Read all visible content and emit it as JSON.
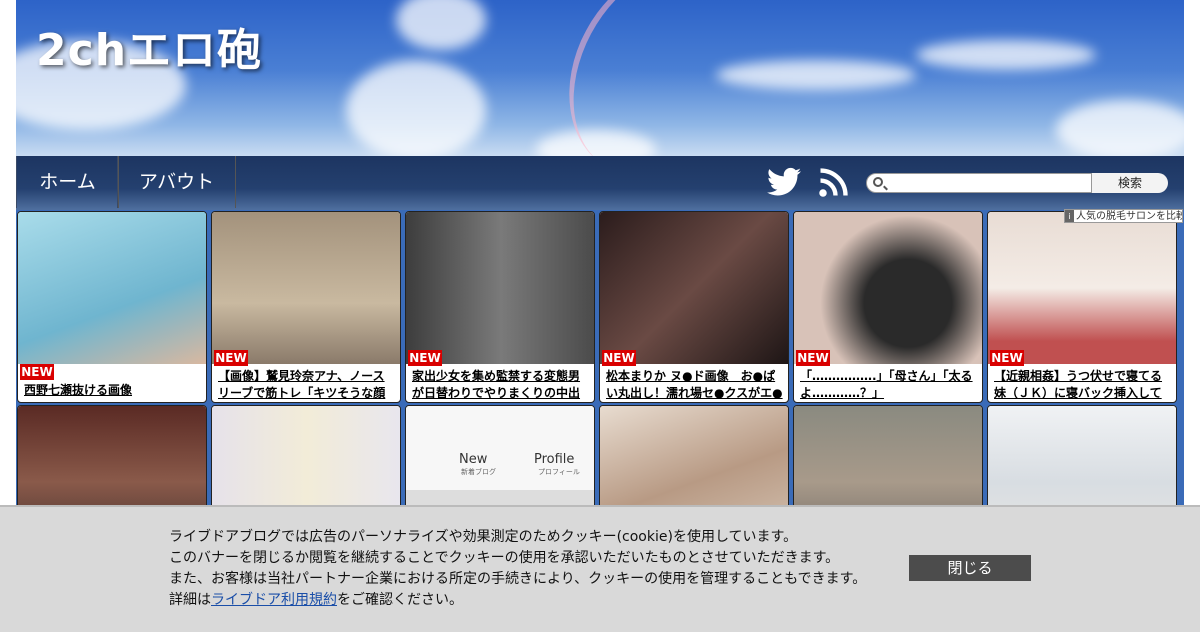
{
  "site": {
    "title": "2chエロ砲"
  },
  "nav": {
    "items": [
      {
        "label": "ホーム"
      },
      {
        "label": "アバウト"
      }
    ]
  },
  "search": {
    "placeholder": "",
    "button_label": "検索"
  },
  "ad": {
    "label": "人気の脱毛サロンを比較"
  },
  "posts": [
    {
      "title": "西野七瀬抜ける画像",
      "badge": "NEW",
      "color": "#8cc3d8"
    },
    {
      "title": "【画像】鷲見玲奈アナ、ノースリーブで筋トレ「キツそうな顔",
      "badge": "NEW",
      "color": "#b9a48c"
    },
    {
      "title": "家出少女を集め監禁する変態男が日替わりでやりまくりの中出",
      "badge": "NEW",
      "color": "#5b5b5b"
    },
    {
      "title": "松本まりか ヌ●ド画像　お●ぱい丸出し！濡れ場セ●クスがエ●す",
      "badge": "NEW",
      "color": "#3b2a2a"
    },
    {
      "title": "「…………….」「母さん」「太るよ…………？」",
      "badge": "NEW",
      "color": "#c7b3a8"
    },
    {
      "title": "【近親相姦】うつ伏せで寝てる妹（ＪＫ）に寝バック挿入して",
      "badge": "NEW",
      "color": "#d6c2b6"
    }
  ],
  "posts_row2": [
    {
      "color": "#5a3a34"
    },
    {
      "color": "#e8e4e6"
    },
    {
      "color": "#f4f4f4",
      "text_new": "New",
      "text_new_sub": "新着ブログ",
      "text_profile": "Profile",
      "text_profile_sub": "プロフィール"
    },
    {
      "color": "#c9a992"
    },
    {
      "color": "#9a8e86"
    },
    {
      "color": "#e9ecef"
    }
  ],
  "cookie": {
    "line1": "ライブドアブログでは広告のパーソナライズや効果測定のためクッキー(cookie)を使用しています。",
    "line2": "このバナーを閉じるか閲覧を継続することでクッキーの使用を承認いただいたものとさせていただきます。",
    "line3": "また、お客様は当社パートナー企業における所定の手続きにより、クッキーの使用を管理することもできます。",
    "line4_prefix": "詳細は",
    "line4_link": "ライブドア利用規約",
    "line4_suffix": "をご確認ください。",
    "close_label": "閉じる"
  }
}
